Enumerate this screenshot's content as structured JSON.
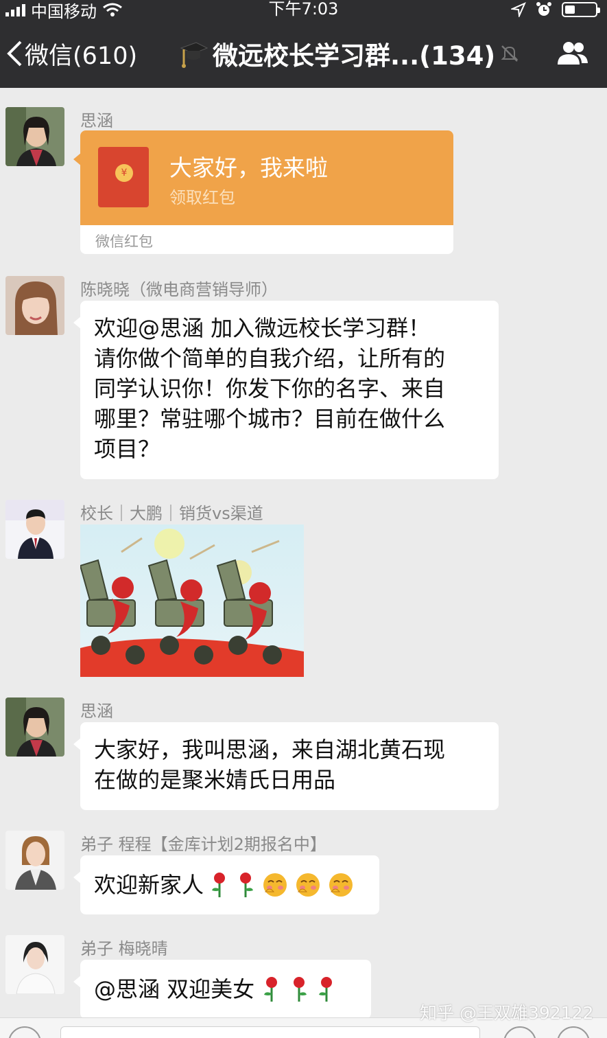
{
  "status": {
    "carrier": "中国移动",
    "time": "下午7:03"
  },
  "nav": {
    "back_label": "微信(610)",
    "title": "微远校长学习群...(134)",
    "icons": [
      "back-chevron-icon",
      "graduation-cap-icon",
      "mute-bell-icon",
      "group-members-icon"
    ]
  },
  "messages": [
    {
      "sender": "思涵",
      "type": "red_packet",
      "packet_title": "大家好，我来啦",
      "packet_sub": "领取红包",
      "packet_footer": "微信红包"
    },
    {
      "sender": "陈晓晓（微电商营销导师）",
      "type": "text",
      "lines": [
        "欢迎@思涵 加入微远校长学习群！",
        "请你做个简单的自我介绍，让所有的",
        "同学认识你！你发下你的名字、来自",
        "哪里？常驻哪个城市？目前在做什么",
        "项目？"
      ]
    },
    {
      "sender": "校长｜大鹏｜销货vs渠道",
      "type": "sticker",
      "sticker_icon": "cannon-fireworks-sticker"
    },
    {
      "sender": "思涵",
      "type": "text",
      "lines": [
        "大家好，我叫思涵，来自湖北黄石现",
        "在做的是聚米婧氏日用品"
      ]
    },
    {
      "sender": "弟子 程程【金库计划2期报名中】",
      "type": "text",
      "lines": [
        "欢迎新家人"
      ],
      "emoji": [
        "rose-icon",
        "rose-icon",
        "blush-face-icon",
        "blush-face-icon",
        "blush-face-icon"
      ]
    },
    {
      "sender": "弟子 梅晓晴",
      "type": "text",
      "lines": [
        "@思涵 双迎美女"
      ],
      "emoji": [
        "rose-icon",
        "rose-icon",
        "rose-icon"
      ]
    }
  ],
  "watermark": "知乎 @王双雄392122",
  "colors": {
    "header": "#2e2e30",
    "chat_bg": "#ebebeb",
    "red_packet": "#f0a349"
  }
}
